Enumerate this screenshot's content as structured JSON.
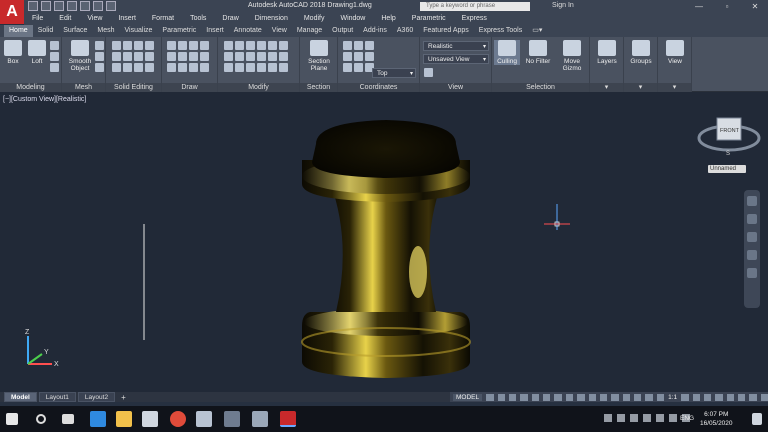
{
  "app": {
    "logo": "A",
    "title": "Autodesk AutoCAD 2018   Drawing1.dwg",
    "search_placeholder": "Type a keyword or phrase",
    "signin": "Sign In"
  },
  "menu": [
    "File",
    "Edit",
    "View",
    "Insert",
    "Format",
    "Tools",
    "Draw",
    "Dimension",
    "Modify",
    "Window",
    "Help",
    "Parametric",
    "Express"
  ],
  "ribbon_tabs": [
    "Home",
    "Solid",
    "Surface",
    "Mesh",
    "Visualize",
    "Parametric",
    "Insert",
    "Annotate",
    "View",
    "Manage",
    "Output",
    "Add-ins",
    "A360",
    "Featured Apps",
    "Express Tools"
  ],
  "active_tab": "Home",
  "ribbon": {
    "box": "Box",
    "loft": "Loft",
    "smooth_object": "Smooth Object",
    "section_plane": "Section Plane",
    "visual_style": "Realistic",
    "saved_view": "Unsaved View",
    "view_top": "Top",
    "culling": "Culling",
    "no_filter": "No Filter",
    "move_gizmo": "Move Gizmo",
    "layers": "Layers",
    "groups": "Groups",
    "view": "View",
    "panels": [
      "Modeling",
      "Mesh",
      "Solid Editing",
      "Draw",
      "Modify",
      "Section",
      "Coordinates",
      "View",
      "Selection"
    ]
  },
  "viewport": {
    "label": "[−][Custom View][Realistic]",
    "viewcube_face": "FRONT",
    "viewcube_s": "S",
    "ucs_label": "Unnamed",
    "axis_z": "Z",
    "axis_y": "Y",
    "axis_x": "X"
  },
  "layouts": [
    "Model",
    "Layout1",
    "Layout2"
  ],
  "status": {
    "model": "MODEL",
    "scale": "1:1"
  },
  "taskbar": {
    "lang": "ENG",
    "time": "6:07 PM",
    "date": "16/05/2020"
  },
  "colors": {
    "viewport_bg": "#212937",
    "gold_highlight": "#e8d24a",
    "accent_red": "#c8292b"
  }
}
